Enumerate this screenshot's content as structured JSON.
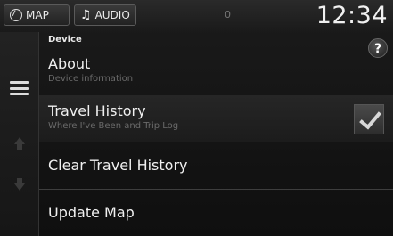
{
  "topbar": {
    "map_label": "MAP",
    "audio_label": "AUDIO",
    "signal": "0",
    "clock": "12:34"
  },
  "content": {
    "section_title": "Device",
    "help": "?",
    "items": [
      {
        "label": "About",
        "sub": "Device information"
      },
      {
        "label": "Travel History",
        "sub": "Where I've Been and Trip Log",
        "checked": true
      },
      {
        "label": "Clear Travel History"
      },
      {
        "label": "Update Map"
      }
    ]
  }
}
